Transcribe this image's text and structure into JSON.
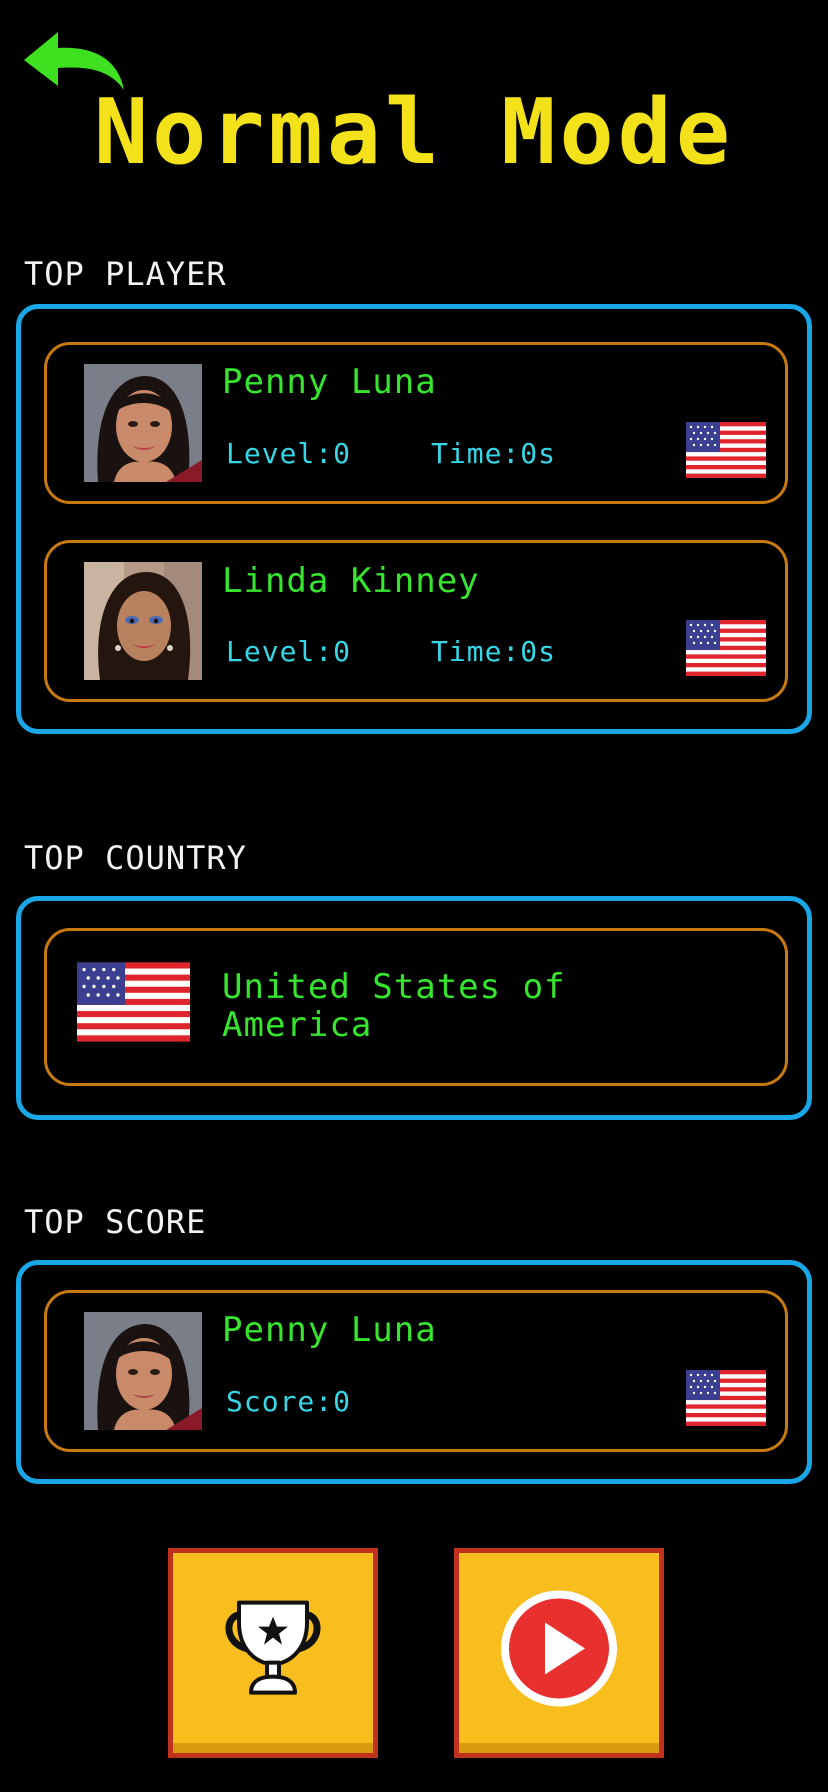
{
  "header": {
    "title": "Normal Mode",
    "back_icon": "back-arrow-icon",
    "back_color": "#3ee020",
    "title_color": "#f3e21a"
  },
  "top_player": {
    "label": "TOP PLAYER",
    "players": [
      {
        "name": "Penny Luna",
        "level": "Level:0",
        "time": "Time:0s",
        "avatar": "player-avatar",
        "flag": "us-flag-icon"
      },
      {
        "name": "Linda Kinney",
        "level": "Level:0",
        "time": "Time:0s",
        "avatar": "player-avatar",
        "flag": "us-flag-icon"
      }
    ]
  },
  "top_country": {
    "label": "TOP COUNTRY",
    "country_name": "United States of\nAmerica",
    "flag": "us-flag-icon"
  },
  "top_score": {
    "label": "TOP SCORE",
    "player": {
      "name": "Penny Luna",
      "score": "Score:0",
      "avatar": "player-avatar",
      "flag": "us-flag-icon"
    }
  },
  "actions": {
    "leaderboard_icon": "trophy-icon",
    "play_icon": "play-icon"
  },
  "colors": {
    "panel_border": "#1aa7e8",
    "card_border": "#c87a10",
    "name_text": "#36e52e",
    "stat_text": "#36d6e6",
    "button_fill": "#f7be1e",
    "button_border": "#c0321d"
  }
}
